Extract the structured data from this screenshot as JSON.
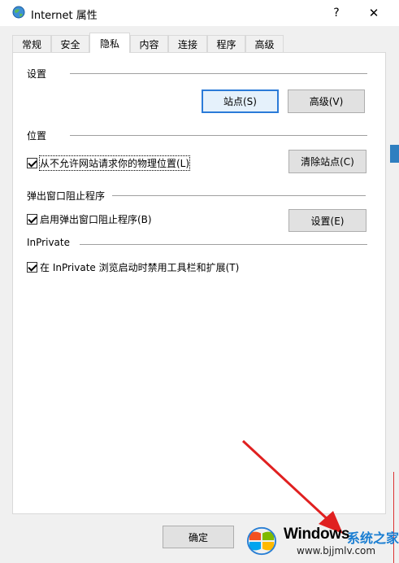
{
  "window": {
    "title": "Internet 属性",
    "help_glyph": "?",
    "close_glyph": "✕"
  },
  "tabs": [
    {
      "label": "常规"
    },
    {
      "label": "安全"
    },
    {
      "label": "隐私",
      "active": true
    },
    {
      "label": "内容"
    },
    {
      "label": "连接"
    },
    {
      "label": "程序"
    },
    {
      "label": "高级"
    }
  ],
  "settings_group": {
    "title": "设置",
    "sites_button": "站点(S)",
    "advanced_button": "高级(V)"
  },
  "location_group": {
    "title": "位置",
    "checkbox_label": "从不允许网站请求你的物理位置(L)",
    "checked": true,
    "clear_sites_button": "清除站点(C)"
  },
  "popup_group": {
    "title": "弹出窗口阻止程序",
    "checkbox_label": "启用弹出窗口阻止程序(B)",
    "checked": true,
    "settings_button": "设置(E)"
  },
  "inprivate_group": {
    "title": "InPrivate",
    "checkbox_label": "在 InPrivate 浏览启动时禁用工具栏和扩展(T)",
    "checked": true
  },
  "footer": {
    "ok_button": "确定"
  },
  "watermark": {
    "brand": "Windows",
    "brand_cn": "系统之家",
    "url": "www.bjjmlv.com"
  },
  "colors": {
    "default_button_border": "#2b7bd8",
    "annotation_arrow": "#e02020",
    "watermark_accent": "#1a7ed2"
  }
}
